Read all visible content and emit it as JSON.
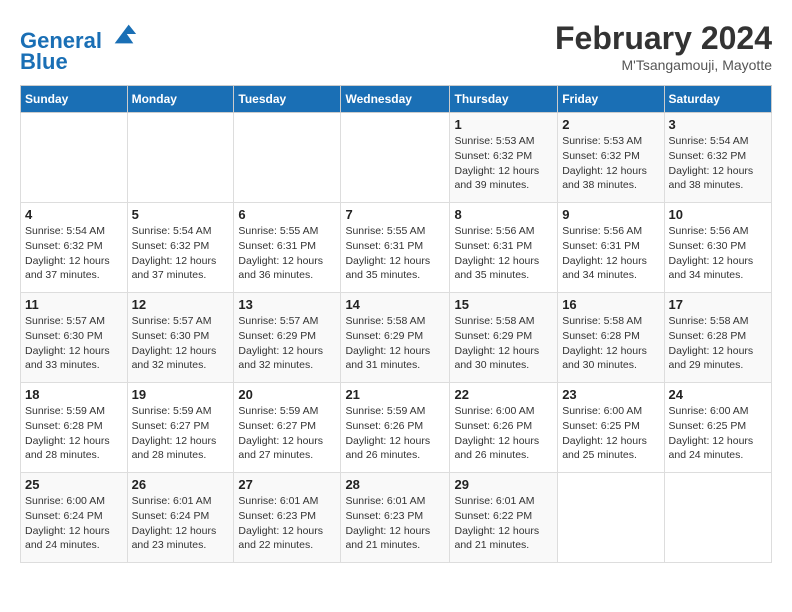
{
  "header": {
    "logo_line1": "General",
    "logo_line2": "Blue",
    "month": "February 2024",
    "location": "M'Tsangamouji, Mayotte"
  },
  "days_of_week": [
    "Sunday",
    "Monday",
    "Tuesday",
    "Wednesday",
    "Thursday",
    "Friday",
    "Saturday"
  ],
  "weeks": [
    [
      {
        "day": "",
        "info": ""
      },
      {
        "day": "",
        "info": ""
      },
      {
        "day": "",
        "info": ""
      },
      {
        "day": "",
        "info": ""
      },
      {
        "day": "1",
        "info": "Sunrise: 5:53 AM\nSunset: 6:32 PM\nDaylight: 12 hours\nand 39 minutes."
      },
      {
        "day": "2",
        "info": "Sunrise: 5:53 AM\nSunset: 6:32 PM\nDaylight: 12 hours\nand 38 minutes."
      },
      {
        "day": "3",
        "info": "Sunrise: 5:54 AM\nSunset: 6:32 PM\nDaylight: 12 hours\nand 38 minutes."
      }
    ],
    [
      {
        "day": "4",
        "info": "Sunrise: 5:54 AM\nSunset: 6:32 PM\nDaylight: 12 hours\nand 37 minutes."
      },
      {
        "day": "5",
        "info": "Sunrise: 5:54 AM\nSunset: 6:32 PM\nDaylight: 12 hours\nand 37 minutes."
      },
      {
        "day": "6",
        "info": "Sunrise: 5:55 AM\nSunset: 6:31 PM\nDaylight: 12 hours\nand 36 minutes."
      },
      {
        "day": "7",
        "info": "Sunrise: 5:55 AM\nSunset: 6:31 PM\nDaylight: 12 hours\nand 35 minutes."
      },
      {
        "day": "8",
        "info": "Sunrise: 5:56 AM\nSunset: 6:31 PM\nDaylight: 12 hours\nand 35 minutes."
      },
      {
        "day": "9",
        "info": "Sunrise: 5:56 AM\nSunset: 6:31 PM\nDaylight: 12 hours\nand 34 minutes."
      },
      {
        "day": "10",
        "info": "Sunrise: 5:56 AM\nSunset: 6:30 PM\nDaylight: 12 hours\nand 34 minutes."
      }
    ],
    [
      {
        "day": "11",
        "info": "Sunrise: 5:57 AM\nSunset: 6:30 PM\nDaylight: 12 hours\nand 33 minutes."
      },
      {
        "day": "12",
        "info": "Sunrise: 5:57 AM\nSunset: 6:30 PM\nDaylight: 12 hours\nand 32 minutes."
      },
      {
        "day": "13",
        "info": "Sunrise: 5:57 AM\nSunset: 6:29 PM\nDaylight: 12 hours\nand 32 minutes."
      },
      {
        "day": "14",
        "info": "Sunrise: 5:58 AM\nSunset: 6:29 PM\nDaylight: 12 hours\nand 31 minutes."
      },
      {
        "day": "15",
        "info": "Sunrise: 5:58 AM\nSunset: 6:29 PM\nDaylight: 12 hours\nand 30 minutes."
      },
      {
        "day": "16",
        "info": "Sunrise: 5:58 AM\nSunset: 6:28 PM\nDaylight: 12 hours\nand 30 minutes."
      },
      {
        "day": "17",
        "info": "Sunrise: 5:58 AM\nSunset: 6:28 PM\nDaylight: 12 hours\nand 29 minutes."
      }
    ],
    [
      {
        "day": "18",
        "info": "Sunrise: 5:59 AM\nSunset: 6:28 PM\nDaylight: 12 hours\nand 28 minutes."
      },
      {
        "day": "19",
        "info": "Sunrise: 5:59 AM\nSunset: 6:27 PM\nDaylight: 12 hours\nand 28 minutes."
      },
      {
        "day": "20",
        "info": "Sunrise: 5:59 AM\nSunset: 6:27 PM\nDaylight: 12 hours\nand 27 minutes."
      },
      {
        "day": "21",
        "info": "Sunrise: 5:59 AM\nSunset: 6:26 PM\nDaylight: 12 hours\nand 26 minutes."
      },
      {
        "day": "22",
        "info": "Sunrise: 6:00 AM\nSunset: 6:26 PM\nDaylight: 12 hours\nand 26 minutes."
      },
      {
        "day": "23",
        "info": "Sunrise: 6:00 AM\nSunset: 6:25 PM\nDaylight: 12 hours\nand 25 minutes."
      },
      {
        "day": "24",
        "info": "Sunrise: 6:00 AM\nSunset: 6:25 PM\nDaylight: 12 hours\nand 24 minutes."
      }
    ],
    [
      {
        "day": "25",
        "info": "Sunrise: 6:00 AM\nSunset: 6:24 PM\nDaylight: 12 hours\nand 24 minutes."
      },
      {
        "day": "26",
        "info": "Sunrise: 6:01 AM\nSunset: 6:24 PM\nDaylight: 12 hours\nand 23 minutes."
      },
      {
        "day": "27",
        "info": "Sunrise: 6:01 AM\nSunset: 6:23 PM\nDaylight: 12 hours\nand 22 minutes."
      },
      {
        "day": "28",
        "info": "Sunrise: 6:01 AM\nSunset: 6:23 PM\nDaylight: 12 hours\nand 21 minutes."
      },
      {
        "day": "29",
        "info": "Sunrise: 6:01 AM\nSunset: 6:22 PM\nDaylight: 12 hours\nand 21 minutes."
      },
      {
        "day": "",
        "info": ""
      },
      {
        "day": "",
        "info": ""
      }
    ]
  ]
}
